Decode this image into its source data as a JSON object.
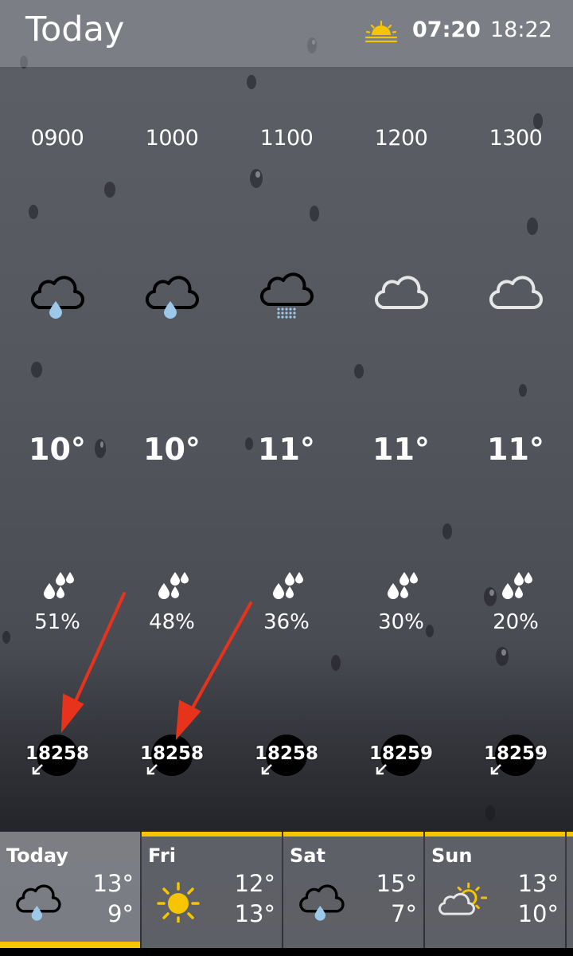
{
  "header": {
    "title": "Today",
    "sunrise": "07:20",
    "sunset": "18:22"
  },
  "hourly": [
    {
      "time": "0900",
      "icon": "cloud-rain-drop-icon",
      "temp": "10°",
      "rain_chance": "51%",
      "wind": "18258"
    },
    {
      "time": "1000",
      "icon": "cloud-rain-drop-icon",
      "temp": "10°",
      "rain_chance": "48%",
      "wind": "18258"
    },
    {
      "time": "1100",
      "icon": "cloud-drizzle-icon",
      "temp": "11°",
      "rain_chance": "36%",
      "wind": "18258"
    },
    {
      "time": "1200",
      "icon": "cloud-icon",
      "temp": "11°",
      "rain_chance": "30%",
      "wind": "18259"
    },
    {
      "time": "1300",
      "icon": "cloud-icon",
      "temp": "11°",
      "rain_chance": "20%",
      "wind": "18259"
    }
  ],
  "daily": [
    {
      "day": "Today",
      "icon": "cloud-rain-drop-icon",
      "high": "13°",
      "low": "9°"
    },
    {
      "day": "Fri",
      "icon": "sun-icon",
      "high": "12°",
      "low": "13°"
    },
    {
      "day": "Sat",
      "icon": "cloud-rain-drop-icon",
      "high": "15°",
      "low": "7°"
    },
    {
      "day": "Sun",
      "icon": "sun-cloud-icon",
      "high": "13°",
      "low": "10°"
    }
  ],
  "colors": {
    "accent": "#f7c400",
    "annotation": "#e8331c",
    "raindrop": "#9cc9ea"
  }
}
